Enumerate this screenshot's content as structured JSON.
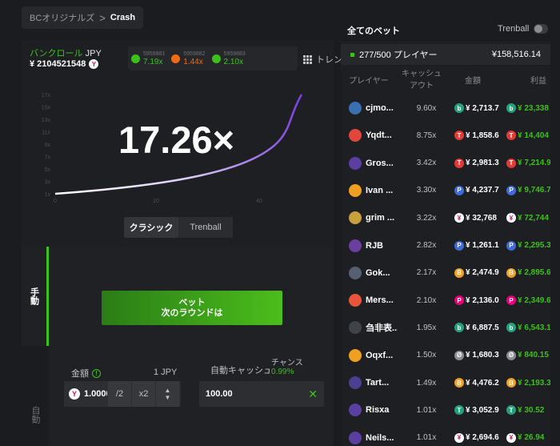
{
  "breadcrumb": {
    "root": "BCオリジナルズ",
    "separator": ">",
    "current": "Crash"
  },
  "bankroll": {
    "label": "バンクロール",
    "currency": "JPY",
    "value": "¥ 2104521548",
    "coin": "Y"
  },
  "history": [
    {
      "id": "5959881",
      "value": "7.19x",
      "color": "#3bc117"
    },
    {
      "id": "5959882",
      "value": "1.44x",
      "color": "#ef6c13"
    },
    {
      "id": "5959883",
      "value": "2.10x",
      "color": "#3bc117"
    }
  ],
  "trend_label": "トレンド",
  "multiplier": "17.26×",
  "chart_data": {
    "type": "line",
    "y_ticks": [
      "1x",
      "3x",
      "5x",
      "7x",
      "9x",
      "11x",
      "13x",
      "15x",
      "17x"
    ],
    "x_ticks": [
      "0",
      "20",
      "40"
    ],
    "curve_color_start": "#ffffff",
    "curve_color_end": "#7b3fe4"
  },
  "mode_tabs": {
    "classic": "クラシック",
    "trenball": "Trenball"
  },
  "side_tabs": {
    "manual": "手動",
    "auto": "自動"
  },
  "bet_button": {
    "line1": "ベット",
    "line2": "次のラウンドは"
  },
  "amount": {
    "label": "金額",
    "unit": "1 JPY",
    "value": "1.0000",
    "half": "/2",
    "double": "x2",
    "coin": "Y"
  },
  "auto_cashout": {
    "label": "自動キャッシュ",
    "value": "100.00",
    "chance_label": "チャンス",
    "chance_value": "0.99%"
  },
  "all_bets": {
    "title": "全てのベット",
    "trenball": "Trenball",
    "players": "277/500 プレイヤー",
    "total": "¥158,516.14",
    "headers": {
      "player": "プレイヤー",
      "cashout": "キャッシュアウト",
      "amount": "金額",
      "profit": "利益"
    },
    "rows": [
      {
        "name": "cjmo...",
        "cashout": "9.60x",
        "amount": "¥ 2,713.7",
        "profit": "¥ 23,338",
        "avatar": "#3a6fb0",
        "coin": "#26a17b",
        "coin_char": "b"
      },
      {
        "name": "Yqdt...",
        "cashout": "8.75x",
        "amount": "¥ 1,858.6",
        "profit": "¥ 14,404",
        "avatar": "#e0463b",
        "coin": "#e53935",
        "coin_char": "T"
      },
      {
        "name": "Gros...",
        "cashout": "3.42x",
        "amount": "¥ 2,981.3",
        "profit": "¥ 7,214.9",
        "avatar": "#5b3fa0",
        "coin": "#e53935",
        "coin_char": "T"
      },
      {
        "name": "Ivan ...",
        "cashout": "3.30x",
        "amount": "¥ 4,237.7",
        "profit": "¥ 9,746.7",
        "avatar": "#f0a020",
        "coin": "#3f6bd8",
        "coin_char": "P"
      },
      {
        "name": "grim ...",
        "cashout": "3.22x",
        "amount": "¥ 32,768",
        "profit": "¥ 72,744",
        "avatar": "#c8a040",
        "coin": "#ffffff",
        "coin_char": "¥"
      },
      {
        "name": "RJB",
        "cashout": "2.82x",
        "amount": "¥ 1,261.1",
        "profit": "¥ 2,295.3",
        "avatar": "#6a3fa0",
        "coin": "#3f6bd8",
        "coin_char": "P"
      },
      {
        "name": "Gok...",
        "cashout": "2.17x",
        "amount": "¥ 2,474.9",
        "profit": "¥ 2,895.6",
        "avatar": "#556070",
        "coin": "#f29f22",
        "coin_char": "B"
      },
      {
        "name": "Mers...",
        "cashout": "2.10x",
        "amount": "¥ 2,136.0",
        "profit": "¥ 2,349.6",
        "avatar": "#e8553a",
        "coin": "#e6007a",
        "coin_char": "P"
      },
      {
        "name": "刍非表...",
        "cashout": "1.95x",
        "amount": "¥ 6,887.5",
        "profit": "¥ 6,543.1",
        "avatar": "#404448",
        "coin": "#26a17b",
        "coin_char": "b"
      },
      {
        "name": "Oqxf...",
        "cashout": "1.50x",
        "amount": "¥ 1,680.3",
        "profit": "¥ 840.15",
        "avatar": "#f0a020",
        "coin": "#8a8d91",
        "coin_char": "Ø"
      },
      {
        "name": "Tart...",
        "cashout": "1.49x",
        "amount": "¥ 4,476.2",
        "profit": "¥ 2,193.3",
        "avatar": "#4a3f90",
        "coin": "#f29f22",
        "coin_char": "B"
      },
      {
        "name": "Risxa",
        "cashout": "1.01x",
        "amount": "¥ 3,052.9",
        "profit": "¥ 30.52",
        "avatar": "#5b3fa0",
        "coin": "#26a17b",
        "coin_char": "T"
      },
      {
        "name": "Neils...",
        "cashout": "1.01x",
        "amount": "¥ 2,694.6",
        "profit": "¥ 26.94",
        "avatar": "#5b3fa0",
        "coin": "#ffffff",
        "coin_char": "¥"
      }
    ]
  }
}
